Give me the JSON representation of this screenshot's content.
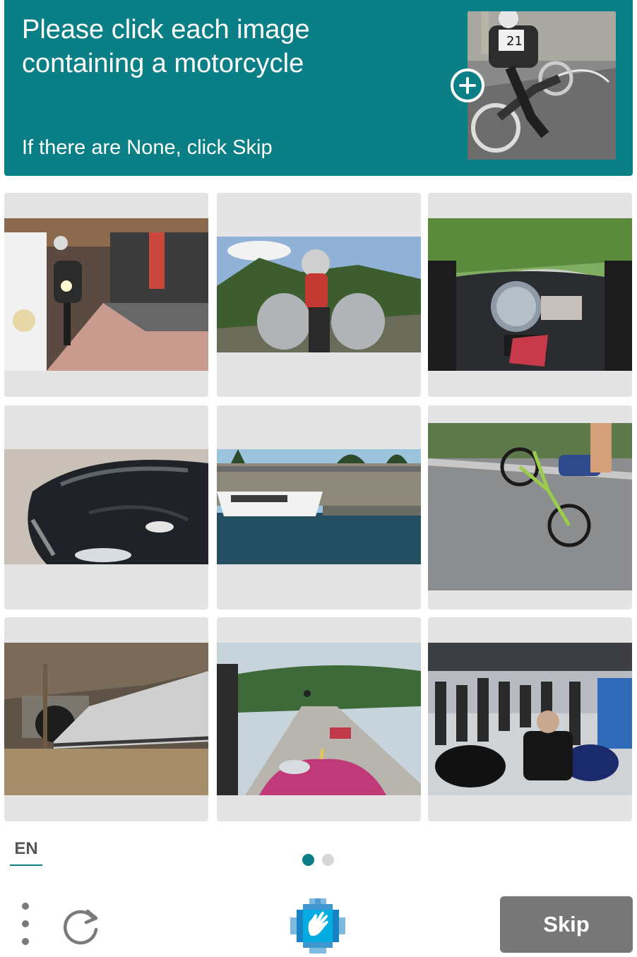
{
  "header": {
    "prompt": "Please click each image containing a motorcycle",
    "hint": "If there are None, click Skip",
    "example_image": "motorcycle-example",
    "background_color": "#0b7f86"
  },
  "tiles": [
    {
      "label": "motorcycle-at-storefront"
    },
    {
      "label": "rider-pov-motorcycle"
    },
    {
      "label": "motorcycle-dashboard"
    },
    {
      "label": "black-car-hood"
    },
    {
      "label": "boat-at-harbor"
    },
    {
      "label": "bicycle-wheelie"
    },
    {
      "label": "freight-train-tunnel"
    },
    {
      "label": "scooter-pov-road"
    },
    {
      "label": "motorcycle-show-crowd"
    }
  ],
  "footer": {
    "language": "EN",
    "skip_label": "Skip",
    "page_count": 2,
    "active_page": 1,
    "menu_icon": "vertical-dots-icon",
    "refresh_icon": "refresh-icon",
    "logo_icon": "hcaptcha-hand-logo"
  },
  "colors": {
    "accent": "#0b7f86",
    "tile_bg": "#e4e4e4",
    "skip_bg": "#777777"
  }
}
